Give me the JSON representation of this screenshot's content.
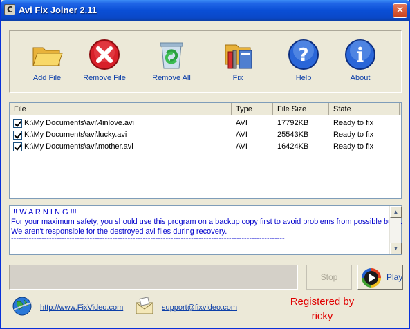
{
  "window": {
    "title": "Avi Fix Joiner 2.11",
    "close_glyph": "✕"
  },
  "toolbar": {
    "items": [
      {
        "label": "Add File",
        "icon": "folder-open-icon"
      },
      {
        "label": "Remove File",
        "icon": "red-x-icon"
      },
      {
        "label": "Remove All",
        "icon": "recycle-bin-icon"
      },
      {
        "label": "Fix",
        "icon": "tools-icon"
      },
      {
        "label": "Help",
        "icon": "help-icon"
      },
      {
        "label": "About",
        "icon": "info-icon"
      }
    ]
  },
  "file_list": {
    "columns": [
      "File",
      "Type",
      "File Size",
      "State"
    ],
    "rows": [
      {
        "checked": true,
        "file": "K:\\My Documents\\avi\\4inlove.avi",
        "type": "AVI",
        "size": "17792KB",
        "state": "Ready to fix"
      },
      {
        "checked": true,
        "file": "K:\\My Documents\\avi\\lucky.avi",
        "type": "AVI",
        "size": "25543KB",
        "state": "Ready to fix"
      },
      {
        "checked": true,
        "file": "K:\\My Documents\\avi\\mother.avi",
        "type": "AVI",
        "size": "16424KB",
        "state": "Ready to fix"
      }
    ]
  },
  "warning": {
    "lines": [
      "!!! W A R N I N G !!!",
      "For your maximum safety, you should use this program on a backup copy first to avoid problems from possible bugs.",
      "We aren't responsible for the destroyed avi files during recovery.",
      "------------------------------------------------------------------------------------------------------------"
    ]
  },
  "controls": {
    "stop_label": "Stop",
    "play_label": "Play"
  },
  "footer": {
    "website": "http://www.FixVideo.com",
    "email": "support@fixvideo.com",
    "registered_line1": "Registered by",
    "registered_line2": "ricky"
  },
  "colors": {
    "accent": "#0b3ea8",
    "title_bar": "#0a4fd6",
    "registered": "#e00000",
    "warning_text": "#0000cc"
  }
}
